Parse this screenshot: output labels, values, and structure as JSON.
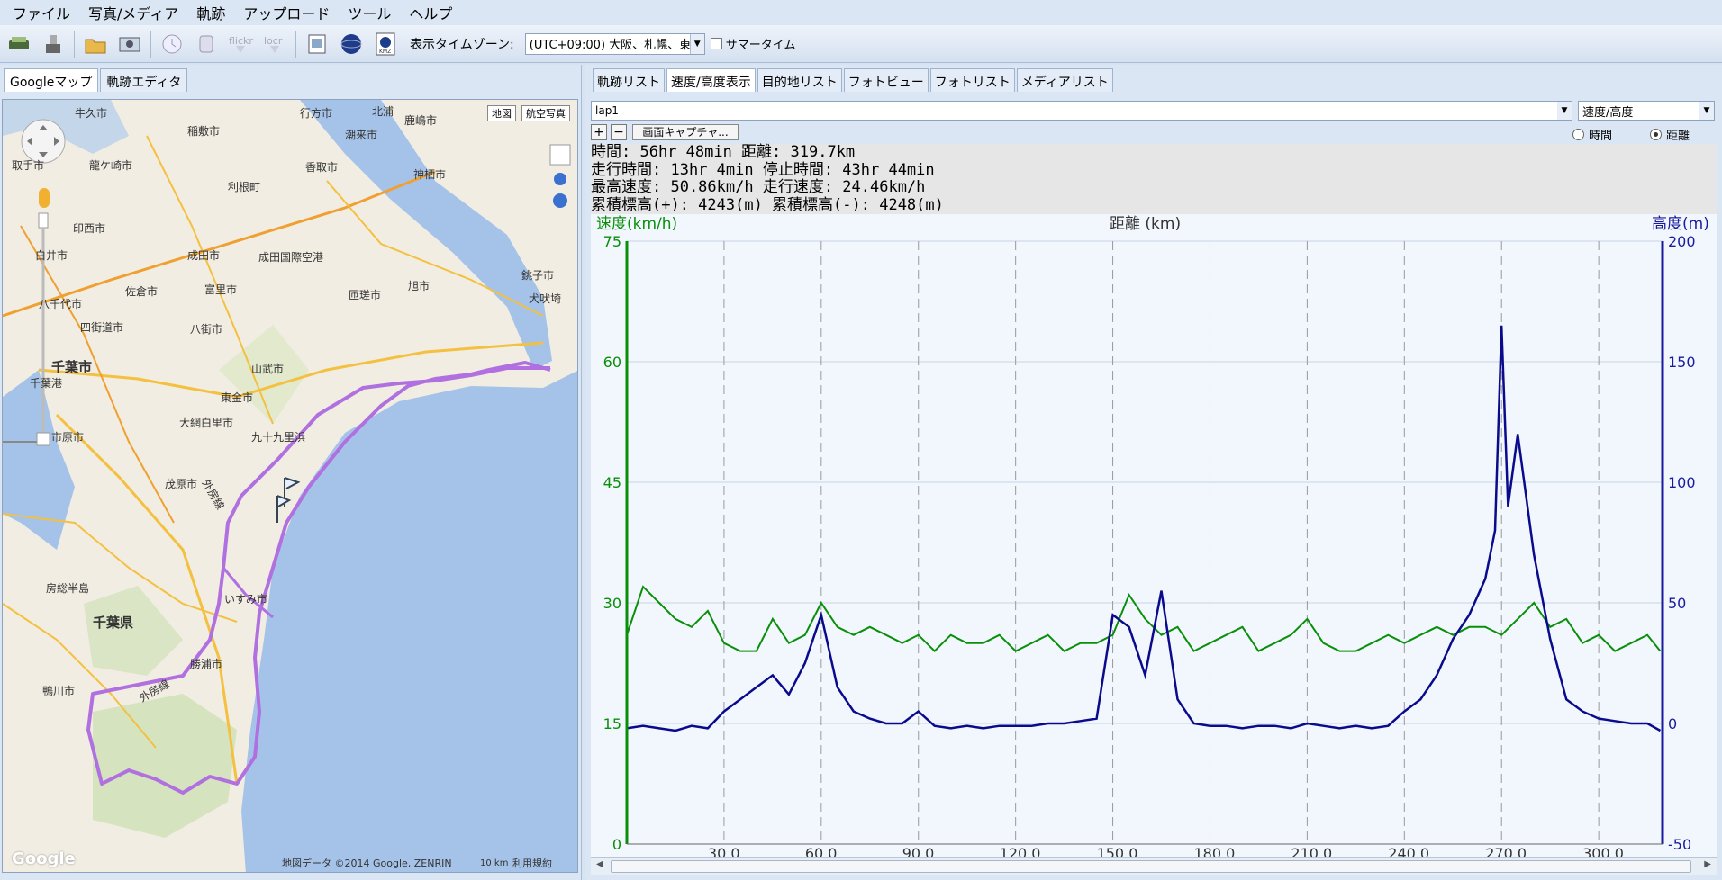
{
  "menu": [
    "ファイル",
    "写真/メディア",
    "軌跡",
    "アップロード",
    "ツール",
    "ヘルプ"
  ],
  "toolbar": {
    "icons": [
      "save-icon",
      "import-icon",
      "folder-icon",
      "photo-icon",
      "clock-icon",
      "tag-icon",
      "flickr-icon",
      "locr-icon",
      "export-icon",
      "globe-icon",
      "kmz-icon"
    ],
    "timezone_label": "表示タイムゾーン:",
    "timezone_value": "(UTC+09:00) 大阪、札幌、東京",
    "dst_label": "サマータイム"
  },
  "left_tabs": [
    "Googleマップ",
    "軌跡エディタ"
  ],
  "map": {
    "btn_map": "地図",
    "btn_sat": "航空写真",
    "attribution": "地図データ ©2014 Google, ZENRIN",
    "scale": "10 km",
    "terms": "利用規約",
    "logo": "Google",
    "labels": [
      "牛久市",
      "稲敷市",
      "龍ケ崎市",
      "取手市",
      "利根町",
      "印西市",
      "白井市",
      "成田市",
      "富里市",
      "佐倉市",
      "四街道市",
      "八千代市",
      "八街市",
      "千葉市",
      "千葉港",
      "山武市",
      "東金市",
      "大網白里市",
      "九十九里浜",
      "市原市",
      "茂原市",
      "房総半島",
      "千葉県",
      "いすみ市",
      "勝浦市",
      "鴨川市",
      "旭市",
      "匝瑳市",
      "銚子市",
      "犬吠埼",
      "神栖市",
      "香取市",
      "潮来市",
      "鹿嶋市",
      "北浦",
      "行方市",
      "成田国際空港",
      "外房線",
      "外房線"
    ]
  },
  "right_tabs": [
    "軌跡リスト",
    "速度/高度表示",
    "目的地リスト",
    "フォトビュー",
    "フォトリスト",
    "メディアリスト"
  ],
  "lap": "lap1",
  "mode": "速度/高度",
  "capture_button": "画面キャプチャ...",
  "radio_time": "時間",
  "radio_distance": "距離",
  "stats": [
    "時間: 56hr 48min 距離: 319.7km",
    "走行時間: 13hr 4min 停止時間: 43hr 44min",
    "最高速度: 50.86km/h 走行速度: 24.46km/h",
    "累積標高(+): 4243(m) 累積標高(-): 4248(m)"
  ],
  "chart_data": {
    "type": "line",
    "title": "距離 (km)",
    "y_left_label": "速度(km/h)",
    "y_right_label": "高度(m)",
    "x_range": [
      0,
      319.7
    ],
    "x_ticks": [
      "30.0",
      "60.0",
      "90.0",
      "120.0",
      "150.0",
      "180.0",
      "210.0",
      "240.0",
      "270.0",
      "300.0"
    ],
    "y_left_range": [
      0,
      75
    ],
    "y_left_ticks": [
      "75",
      "60",
      "45",
      "30",
      "15",
      "0"
    ],
    "y_right_range": [
      -50,
      200
    ],
    "y_right_ticks": [
      "200",
      "150",
      "100",
      "50",
      "0",
      "-50"
    ],
    "series": [
      {
        "name": "速度(km/h)",
        "color": "#0a8f0a",
        "x": [
          0,
          5,
          10,
          15,
          20,
          25,
          30,
          35,
          40,
          45,
          50,
          55,
          60,
          65,
          70,
          75,
          80,
          85,
          90,
          95,
          100,
          105,
          110,
          115,
          120,
          125,
          130,
          135,
          140,
          145,
          150,
          155,
          160,
          165,
          170,
          175,
          180,
          185,
          190,
          195,
          200,
          205,
          210,
          215,
          220,
          225,
          230,
          235,
          240,
          245,
          250,
          255,
          260,
          265,
          270,
          275,
          280,
          285,
          290,
          295,
          300,
          305,
          310,
          315,
          319
        ],
        "values": [
          26,
          32,
          30,
          28,
          27,
          29,
          25,
          24,
          24,
          28,
          25,
          26,
          30,
          27,
          26,
          27,
          26,
          25,
          26,
          24,
          26,
          25,
          25,
          26,
          24,
          25,
          26,
          24,
          25,
          25,
          26,
          31,
          28,
          26,
          27,
          24,
          25,
          26,
          27,
          24,
          25,
          26,
          28,
          25,
          24,
          24,
          25,
          26,
          25,
          26,
          27,
          26,
          27,
          27,
          26,
          28,
          30,
          27,
          28,
          25,
          26,
          24,
          25,
          26,
          24
        ]
      },
      {
        "name": "高度(m)",
        "color": "#0a0a8c",
        "x": [
          0,
          5,
          10,
          15,
          20,
          25,
          30,
          35,
          40,
          45,
          50,
          55,
          60,
          65,
          70,
          75,
          80,
          85,
          90,
          95,
          100,
          105,
          110,
          115,
          120,
          125,
          130,
          135,
          140,
          145,
          150,
          155,
          160,
          165,
          170,
          175,
          180,
          185,
          190,
          195,
          200,
          205,
          210,
          215,
          220,
          225,
          230,
          235,
          240,
          245,
          250,
          255,
          260,
          265,
          268,
          270,
          272,
          275,
          278,
          280,
          285,
          290,
          295,
          300,
          305,
          310,
          315,
          319
        ],
        "values": [
          -2,
          -1,
          -2,
          -3,
          -1,
          -2,
          5,
          10,
          15,
          20,
          12,
          25,
          45,
          15,
          5,
          2,
          0,
          0,
          5,
          -1,
          -2,
          -1,
          -2,
          -1,
          -1,
          -1,
          0,
          0,
          1,
          2,
          45,
          40,
          20,
          55,
          10,
          0,
          -1,
          -1,
          -2,
          -1,
          -1,
          -2,
          0,
          -1,
          -2,
          -1,
          -2,
          -1,
          5,
          10,
          20,
          35,
          45,
          60,
          80,
          165,
          90,
          120,
          90,
          70,
          35,
          10,
          5,
          2,
          1,
          0,
          0,
          -3
        ]
      }
    ]
  }
}
